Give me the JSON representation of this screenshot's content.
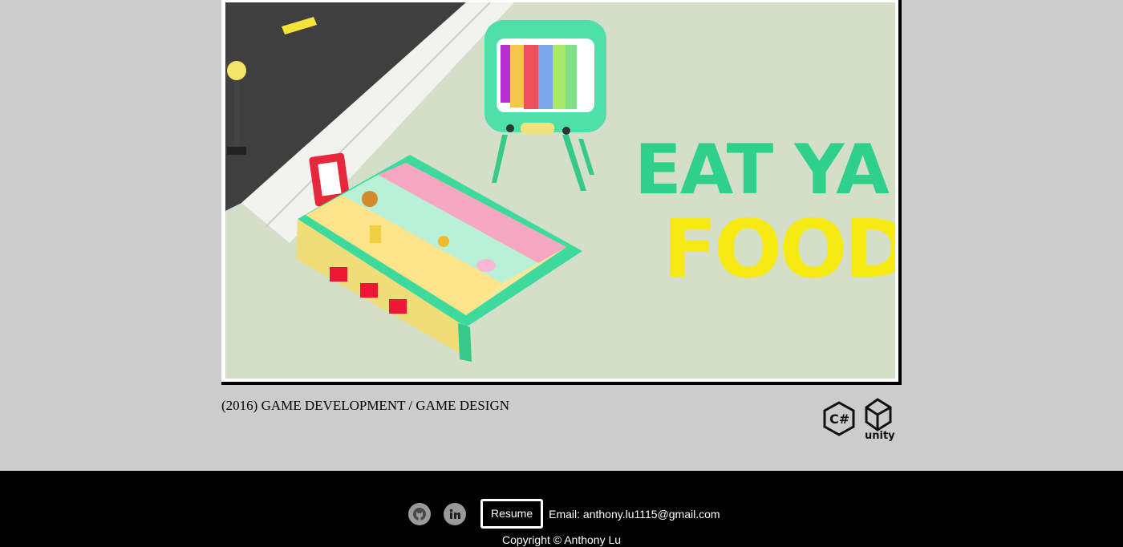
{
  "project": {
    "image_alt": "Eat Ya Food",
    "caption": "(2016) GAME DEVELOPMENT / GAME DESIGN",
    "artwork_text": {
      "line1": "EAT YA",
      "line2": "FOOD"
    },
    "tech": [
      {
        "name": "csharp-icon",
        "label": "C#"
      },
      {
        "name": "unity-icon",
        "label": "unity"
      }
    ]
  },
  "footer": {
    "social": [
      {
        "name": "github-icon"
      },
      {
        "name": "linkedin-icon"
      }
    ],
    "resume_label": "Resume",
    "email_text": "Email: anthony.lu1115@gmail.com",
    "copyright": "Copyright © Anthony Lu"
  },
  "colors": {
    "page_bg": "#cccccc",
    "footer_bg": "#000000",
    "mint": "#3ee0a0",
    "yellow": "#fff200"
  }
}
